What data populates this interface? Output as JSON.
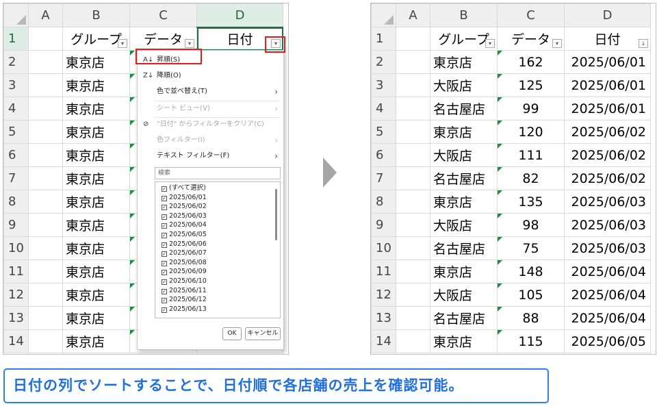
{
  "columns": [
    "A",
    "B",
    "C",
    "D"
  ],
  "left_sheet": {
    "header": {
      "group": "グループ",
      "data": "データ",
      "date": "日付"
    },
    "row_numbers": [
      "1",
      "2",
      "3",
      "4",
      "5",
      "6",
      "7",
      "8",
      "9",
      "10",
      "11",
      "12",
      "13",
      "14"
    ],
    "rows": [
      "東京店",
      "東京店",
      "東京店",
      "東京店",
      "東京店",
      "東京店",
      "東京店",
      "東京店",
      "東京店",
      "東京店",
      "東京店",
      "東京店",
      "東京店"
    ]
  },
  "filter_menu": {
    "sort_asc": "昇順(S)",
    "sort_desc": "降順(O)",
    "sort_by_color": "色で並べ替え(T)",
    "sheet_view": "シート ビュー(V)",
    "clear_filter": "\"日付\" からフィルターをクリア(C)",
    "color_filter": "色フィルター(I)",
    "text_filter": "テキスト フィルター(F)",
    "search_placeholder": "検索",
    "items": [
      "(すべて選択)",
      "2025/06/01",
      "2025/06/02",
      "2025/06/03",
      "2025/06/04",
      "2025/06/05",
      "2025/06/06",
      "2025/06/07",
      "2025/06/08",
      "2025/06/09",
      "2025/06/10",
      "2025/06/11",
      "2025/06/12",
      "2025/06/13"
    ],
    "ok": "OK",
    "cancel": "キャンセル"
  },
  "right_sheet": {
    "header": {
      "group": "グループ",
      "data": "データ",
      "date": "日付"
    },
    "row_numbers": [
      "1",
      "2",
      "3",
      "4",
      "5",
      "6",
      "7",
      "8",
      "9",
      "10",
      "11",
      "12",
      "13",
      "14"
    ],
    "rows": [
      {
        "group": "東京店",
        "value": "162",
        "date": "2025/06/01"
      },
      {
        "group": "大阪店",
        "value": "125",
        "date": "2025/06/01"
      },
      {
        "group": "名古屋店",
        "value": "99",
        "date": "2025/06/01"
      },
      {
        "group": "東京店",
        "value": "120",
        "date": "2025/06/02"
      },
      {
        "group": "大阪店",
        "value": "111",
        "date": "2025/06/02"
      },
      {
        "group": "名古屋店",
        "value": "82",
        "date": "2025/06/02"
      },
      {
        "group": "東京店",
        "value": "135",
        "date": "2025/06/03"
      },
      {
        "group": "大阪店",
        "value": "98",
        "date": "2025/06/03"
      },
      {
        "group": "名古屋店",
        "value": "75",
        "date": "2025/06/03"
      },
      {
        "group": "東京店",
        "value": "148",
        "date": "2025/06/04"
      },
      {
        "group": "大阪店",
        "value": "105",
        "date": "2025/06/04"
      },
      {
        "group": "名古屋店",
        "value": "88",
        "date": "2025/06/04"
      },
      {
        "group": "東京店",
        "value": "115",
        "date": "2025/06/05"
      }
    ]
  },
  "caption": "日付の列でソートすることで、日付順で各店舗の売上を確認可能。",
  "colors": {
    "highlight_red": "#e21b1b",
    "caption_blue": "#2f80ed",
    "excel_green": "#1e7145"
  }
}
